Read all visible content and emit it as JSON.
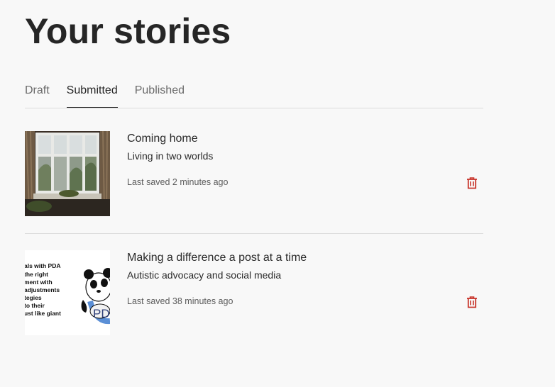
{
  "page": {
    "title": "Your stories"
  },
  "tabs": [
    {
      "label": "Draft",
      "active": false
    },
    {
      "label": "Submitted",
      "active": true
    },
    {
      "label": "Published",
      "active": false
    }
  ],
  "stories": [
    {
      "title": "Coming home",
      "subtitle": "Living in two worlds",
      "last_saved": "Last saved 2 minutes ago",
      "thumbnail": "window-photo"
    },
    {
      "title": "Making a difference a post at a time",
      "subtitle": "Autistic advocacy and social media",
      "last_saved": "Last saved 38 minutes ago",
      "thumbnail": "panda-pda-graphic",
      "thumbnail_text": [
        "als with PDA",
        "the right",
        "ment with",
        "adjustments",
        "tegies",
        "to their",
        "ust like giant",
        "PD"
      ]
    }
  ],
  "colors": {
    "background": "#f8f8f8",
    "delete_icon": "#c8352b",
    "divider": "#dcdcdc"
  },
  "icons": {
    "delete": "trash-icon"
  }
}
